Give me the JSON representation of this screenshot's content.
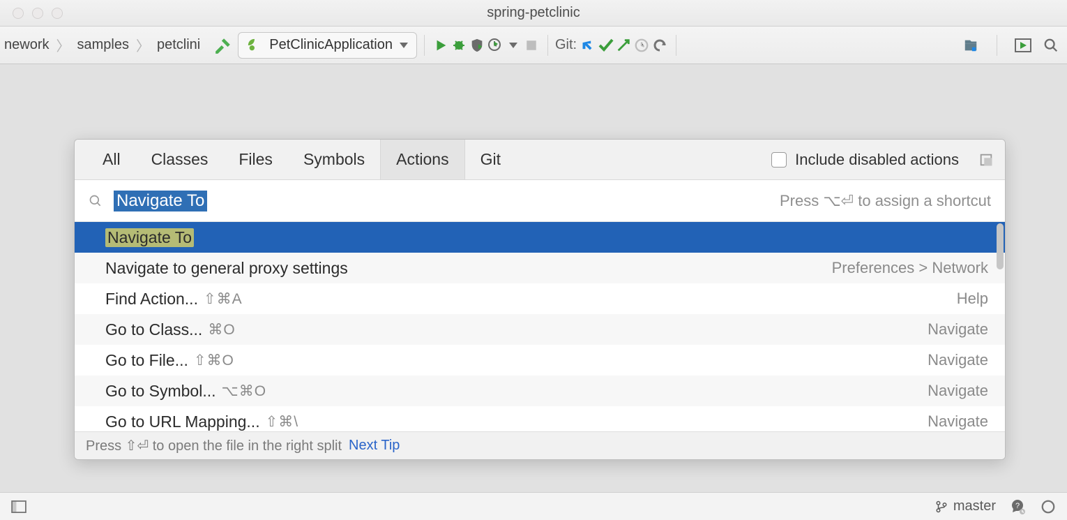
{
  "window": {
    "title": "spring-petclinic"
  },
  "breadcrumbs": {
    "seg0": "nework",
    "seg1": "samples",
    "seg2": "petclini"
  },
  "run_config": {
    "label": "PetClinicApplication"
  },
  "git": {
    "label": "Git:"
  },
  "popup": {
    "tabs": {
      "all": "All",
      "classes": "Classes",
      "files": "Files",
      "symbols": "Symbols",
      "actions": "Actions",
      "git": "Git"
    },
    "include_label": "Include disabled actions",
    "query": "Navigate To",
    "hint": "Press ⌥⏎ to assign a shortcut",
    "results": [
      {
        "label": "Navigate To",
        "shortcut": "",
        "meta": "",
        "selected": true
      },
      {
        "label": "Navigate to general proxy settings",
        "shortcut": "",
        "meta": "Preferences > Network"
      },
      {
        "label": "Find Action...",
        "shortcut": "⇧⌘A",
        "meta": "Help"
      },
      {
        "label": "Go to Class...",
        "shortcut": "⌘O",
        "meta": "Navigate"
      },
      {
        "label": "Go to File...",
        "shortcut": "⇧⌘O",
        "meta": "Navigate"
      },
      {
        "label": "Go to Symbol...",
        "shortcut": "⌥⌘O",
        "meta": "Navigate"
      },
      {
        "label": "Go to URL Mapping...",
        "shortcut": "⇧⌘\\",
        "meta": "Navigate"
      }
    ],
    "footer_text": "Press ⇧⏎ to open the file in the right split",
    "next_tip": "Next Tip"
  },
  "status": {
    "branch": "master"
  }
}
